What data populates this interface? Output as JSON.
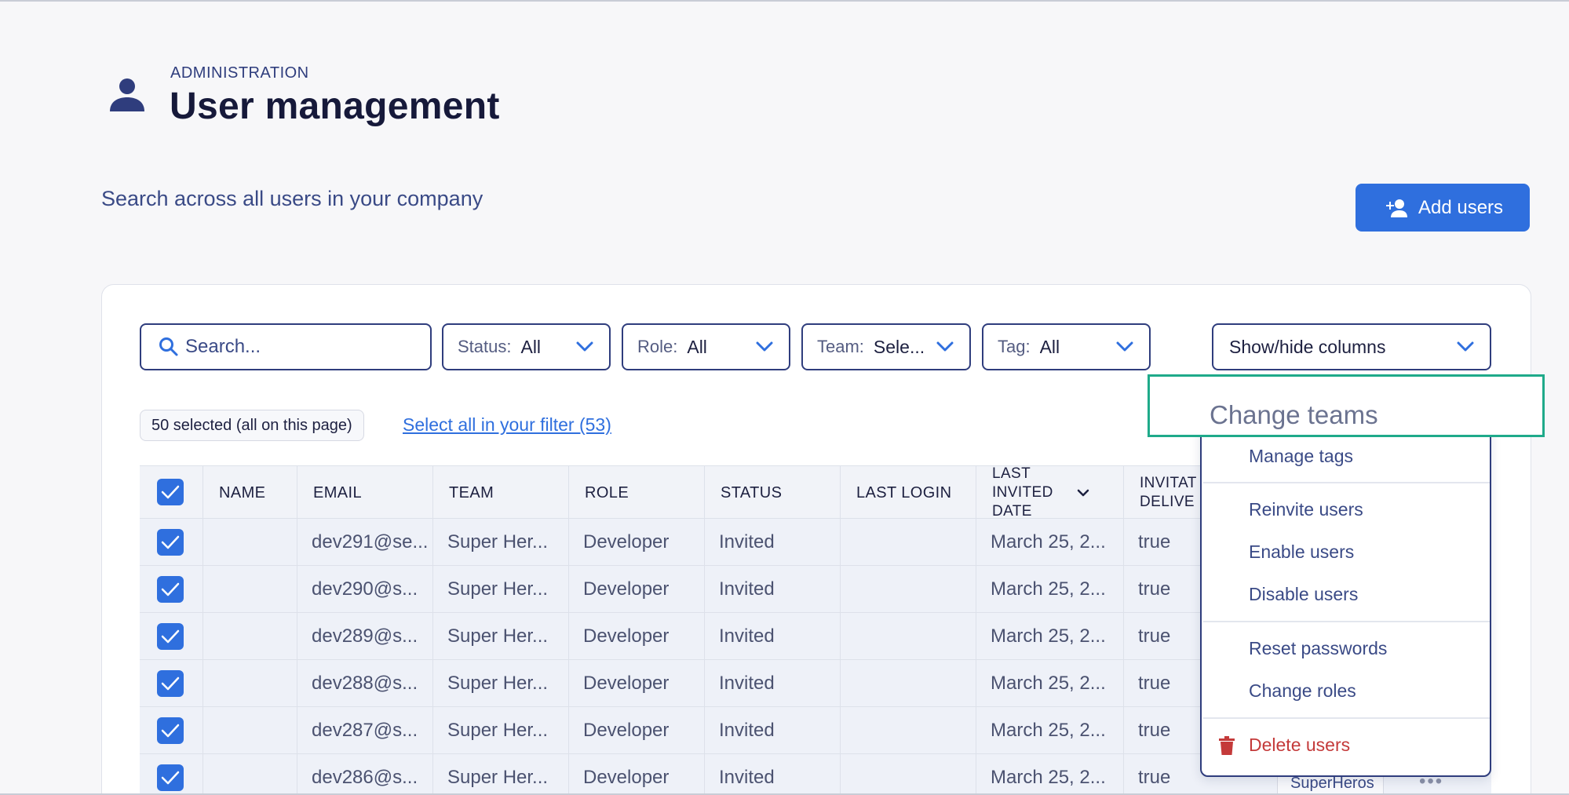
{
  "header": {
    "eyebrow": "ADMINISTRATION",
    "title": "User management",
    "icon": "person-icon"
  },
  "subtitle": "Search across all users in your company",
  "add_button": {
    "label": "Add users",
    "icon": "person-add-icon"
  },
  "filters": {
    "search_placeholder": "Search...",
    "status": {
      "label": "Status:",
      "value": "All"
    },
    "role": {
      "label": "Role:",
      "value": "All"
    },
    "team": {
      "label": "Team:",
      "value": "Sele..."
    },
    "tag": {
      "label": "Tag:",
      "value": "All"
    },
    "columns": {
      "value": "Show/hide columns"
    }
  },
  "selection": {
    "chip": "50 selected (all on this page)",
    "link": "Select all in your filter (53)"
  },
  "table": {
    "headers": {
      "name": "NAME",
      "email": "EMAIL",
      "team": "TEAM",
      "role": "ROLE",
      "status": "STATUS",
      "last_login": "LAST LOGIN",
      "last_invited_1": "LAST",
      "last_invited_2": "INVITED",
      "last_invited_3": "DATE",
      "invite_delivered_1": "INVITAT",
      "invite_delivered_2": "DELIVE"
    },
    "rows": [
      {
        "email": "dev291@se...",
        "team": "Super Her...",
        "role": "Developer",
        "status": "Invited",
        "invited": "March 25, 2...",
        "delivered": "true"
      },
      {
        "email": "dev290@s...",
        "team": "Super Her...",
        "role": "Developer",
        "status": "Invited",
        "invited": "March 25, 2...",
        "delivered": "true"
      },
      {
        "email": "dev289@s...",
        "team": "Super Her...",
        "role": "Developer",
        "status": "Invited",
        "invited": "March 25, 2...",
        "delivered": "true"
      },
      {
        "email": "dev288@s...",
        "team": "Super Her...",
        "role": "Developer",
        "status": "Invited",
        "invited": "March 25, 2...",
        "delivered": "true"
      },
      {
        "email": "dev287@s...",
        "team": "Super Her...",
        "role": "Developer",
        "status": "Invited",
        "invited": "March 25, 2...",
        "delivered": "true"
      },
      {
        "email": "dev286@s...",
        "team": "Super Her...",
        "role": "Developer",
        "status": "Invited",
        "invited": "March 25, 2...",
        "delivered": "true"
      }
    ],
    "partial_tag": "SuperHeros"
  },
  "menu": {
    "highlighted": "Change teams",
    "items": {
      "manage_tags": "Manage tags",
      "reinvite": "Reinvite users",
      "enable": "Enable users",
      "disable": "Disable users",
      "reset": "Reset passwords",
      "change_roles": "Change roles",
      "delete": "Delete users"
    }
  },
  "colors": {
    "accent": "#2f6fde",
    "navy": "#2f3d7d",
    "highlight_border": "#1faa8a",
    "danger": "#c43a3a"
  }
}
